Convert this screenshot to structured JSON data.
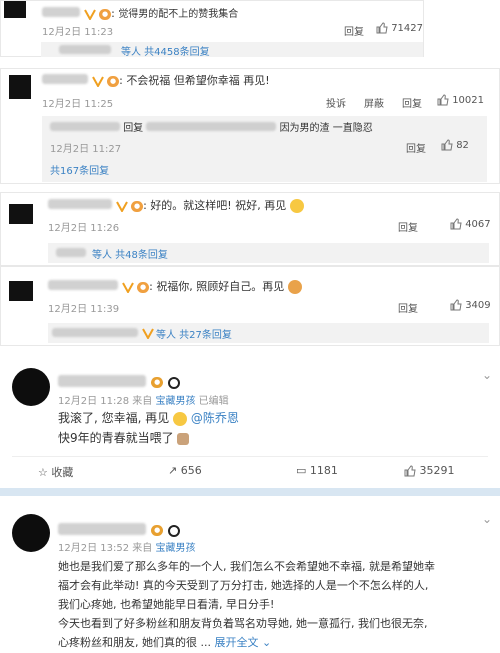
{
  "c1": {
    "text": "觉得男的配不上的赞我集合",
    "time": "12月2日 11:23",
    "reply": "回复",
    "likes": "71427",
    "more_suffix": "等人 共4458条回复"
  },
  "c2": {
    "text": "不会祝福 但希望你幸福 再见!",
    "time": "12月2日 11:25",
    "report": "投诉",
    "block": "屏蔽",
    "reply": "回复",
    "likes": "10021",
    "sub_prefix": "回复",
    "sub_text": "因为男的渣 一直隐忍",
    "sub_time": "12月2日 11:27",
    "sub_reply": "回复",
    "sub_likes": "82",
    "total": "共167条回复"
  },
  "c3": {
    "text": "好的。就这样吧! 祝好, 再见",
    "time": "12月2日 11:26",
    "reply": "回复",
    "likes": "4067",
    "more_suffix": "等人 共48条回复"
  },
  "c4": {
    "text": "祝福你, 照顾好自己。再见",
    "time": "12月2日 11:39",
    "reply": "回复",
    "likes": "3409",
    "more_suffix": "等人 共27条回复"
  },
  "p1": {
    "meta_time": "12月2日 11:28 来自",
    "meta_source": "宝藏男孩",
    "meta_edit": "已编辑",
    "line1_pre": "我滚了, 您幸福, 再见",
    "mention": "@陈乔恩",
    "line2": "快9年的青春就当喂了",
    "collect": "收藏",
    "repost": "656",
    "comment": "1181",
    "like": "35291"
  },
  "p2": {
    "meta_time": "12月2日 13:52 来自",
    "meta_source": "宝藏男孩",
    "line1": "她也是我们爱了那么多年的一个人, 我们怎么不会希望她不幸福, 就是希望她幸",
    "line2": "福才会有此举动! 真的今天受到了万分打击, 她选择的人是一个不怎么样的人,",
    "line3": "我们心疼她, 也希望她能早日看清, 早日分手!",
    "line4": "今天也看到了好多粉丝和朋友背负着骂名劝导她, 她一意孤行, 我们也很无奈,",
    "line5_pre": "心疼粉丝和朋友, 她们真的很",
    "expand": "展开全文"
  }
}
